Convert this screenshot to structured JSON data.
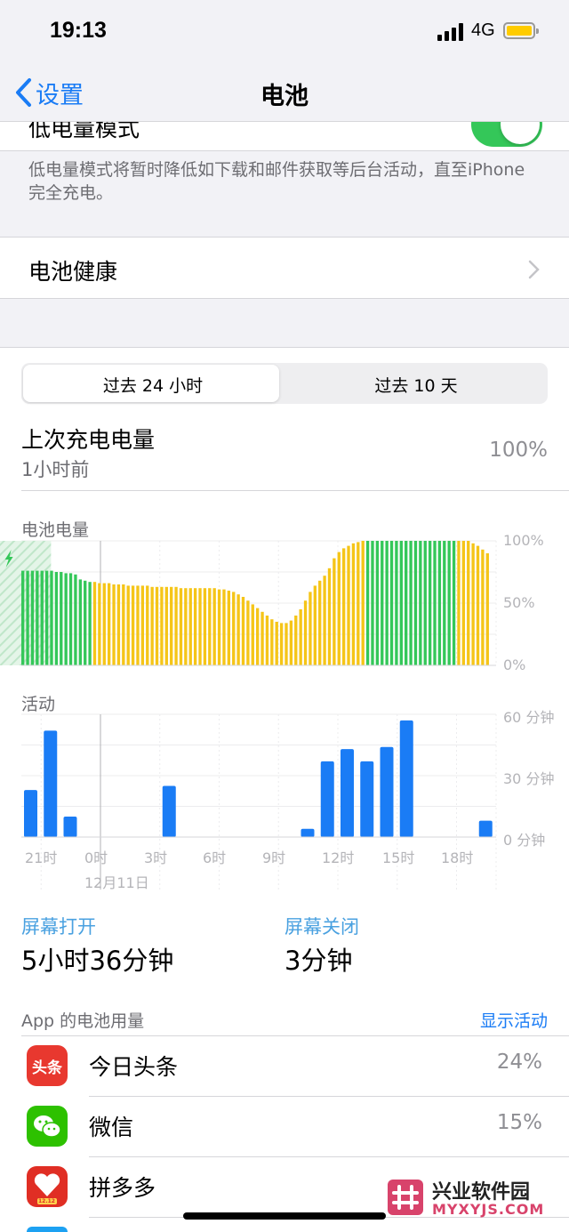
{
  "status": {
    "time": "19:13",
    "network": "4G"
  },
  "nav": {
    "back_label": "设置",
    "title": "电池"
  },
  "low_power": {
    "label": "低电量模式",
    "enabled": true,
    "note": "低电量模式将暂时降低如下载和邮件获取等后台活动，直至iPhone完全充电。"
  },
  "health": {
    "label": "电池健康"
  },
  "segments": {
    "tab1": "过去 24 小时",
    "tab2": "过去 10 天",
    "selected": 0
  },
  "last_charge": {
    "label": "上次充电电量",
    "ago": "1小时前",
    "value": "100%"
  },
  "chart_data": [
    {
      "type": "bar",
      "title": "电池电量",
      "ylabel_ticks": [
        "100%",
        "50%",
        "0%"
      ],
      "ylim": [
        0,
        100
      ],
      "values": [
        76,
        76,
        76,
        76,
        76,
        76,
        76,
        75,
        75,
        74,
        74,
        73,
        69,
        68,
        67,
        67,
        66,
        66,
        66,
        65,
        65,
        65,
        64,
        64,
        64,
        64,
        64,
        63,
        63,
        63,
        63,
        63,
        63,
        62,
        62,
        62,
        62,
        62,
        62,
        62,
        62,
        61,
        61,
        60,
        59,
        57,
        55,
        52,
        49,
        46,
        43,
        40,
        37,
        35,
        34,
        34,
        36,
        40,
        45,
        52,
        59,
        64,
        68,
        72,
        78,
        86,
        91,
        94,
        96,
        98,
        99,
        100,
        100,
        100,
        100,
        100,
        100,
        100,
        100,
        100,
        100,
        100,
        100,
        100,
        100,
        100,
        100,
        100,
        100,
        100,
        100,
        100,
        100,
        100,
        98,
        96,
        93,
        90
      ],
      "low_power_color": "#f5c518",
      "normal_color": "#34c759",
      "charging_window_hours": [
        18.5,
        21.5
      ]
    },
    {
      "type": "bar",
      "title": "活动",
      "ylabel_ticks": [
        "60 分钟",
        "30 分钟",
        "0 分钟"
      ],
      "ylim": [
        0,
        60
      ],
      "x_ticks": [
        "21时",
        "0时",
        "3时",
        "6时",
        "9时",
        "12时",
        "15时",
        "18时"
      ],
      "date_label": "12月11日",
      "hours": [
        3,
        10,
        11,
        12,
        13,
        14,
        15,
        19,
        20,
        21,
        22
      ],
      "values": [
        25,
        4,
        37,
        43,
        37,
        44,
        57,
        8,
        23,
        52,
        10
      ],
      "color": "#1a7cf5"
    }
  ],
  "screen": {
    "on_label": "屏幕打开",
    "on_value": "5小时36分钟",
    "off_label": "屏幕关闭",
    "off_value": "3分钟"
  },
  "apps": {
    "header": "App 的电池用量",
    "show_activity": "显示活动",
    "items": [
      {
        "name": "今日头条",
        "percent": "24%",
        "icon_text": "头条"
      },
      {
        "name": "微信",
        "percent": "15%"
      },
      {
        "name": "拼多多",
        "percent": "",
        "icon_text": "12.12"
      }
    ]
  },
  "watermark": {
    "title": "兴业软件园",
    "url": "MYXYJS.COM"
  }
}
